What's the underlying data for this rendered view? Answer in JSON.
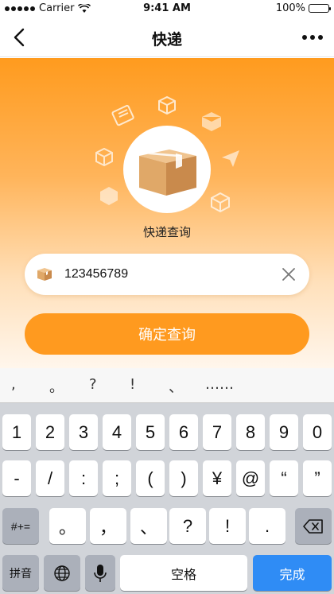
{
  "status_bar": {
    "carrier": "Carrier",
    "time": "9:41 AM",
    "battery": "100%"
  },
  "nav": {
    "title": "快递",
    "back_icon": "chevron-left-icon",
    "more_icon": "more-dots-icon"
  },
  "hero": {
    "label": "快递查询",
    "search_value": "123456789",
    "confirm_label": "确定查询",
    "colors": {
      "accent": "#ff9a1f",
      "box": "#e0a868"
    }
  },
  "keyboard": {
    "suggestions": [
      ",",
      "。",
      "?",
      "!",
      "、",
      "……"
    ],
    "row1": [
      "1",
      "2",
      "3",
      "4",
      "5",
      "6",
      "7",
      "8",
      "9",
      "0"
    ],
    "row2": [
      "-",
      "/",
      ":",
      ";",
      "(",
      ")",
      "¥",
      "@",
      "“",
      "”"
    ],
    "row3_left": "#+=",
    "row3": [
      "。",
      "，",
      "、",
      "?",
      "!",
      "."
    ],
    "bottom": {
      "pinyin": "拼音",
      "space": "空格",
      "done": "完成"
    }
  }
}
